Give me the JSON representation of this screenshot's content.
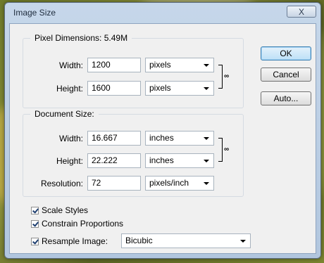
{
  "window": {
    "title": "Image Size",
    "close_glyph": "X"
  },
  "pixel_dimensions": {
    "legend": "Pixel Dimensions:",
    "size": "5.49M",
    "width": {
      "label": "Width:",
      "value": "1200",
      "unit": "pixels"
    },
    "height": {
      "label": "Height:",
      "value": "1600",
      "unit": "pixels"
    }
  },
  "document_size": {
    "legend": "Document Size:",
    "width": {
      "label": "Width:",
      "value": "16.667",
      "unit": "inches"
    },
    "height": {
      "label": "Height:",
      "value": "22.222",
      "unit": "inches"
    },
    "resolution": {
      "label": "Resolution:",
      "value": "72",
      "unit": "pixels/inch"
    }
  },
  "buttons": {
    "ok": "OK",
    "cancel": "Cancel",
    "auto": "Auto..."
  },
  "options": {
    "scale_styles": {
      "label": "Scale Styles",
      "checked": true
    },
    "constrain_proportions": {
      "label": "Constrain Proportions",
      "checked": true
    },
    "resample": {
      "label": "Resample Image:",
      "checked": true,
      "method": "Bicubic"
    }
  },
  "icons": {
    "link": "chain-link-icon",
    "close": "close-icon",
    "dropdown": "chevron-down-icon"
  }
}
